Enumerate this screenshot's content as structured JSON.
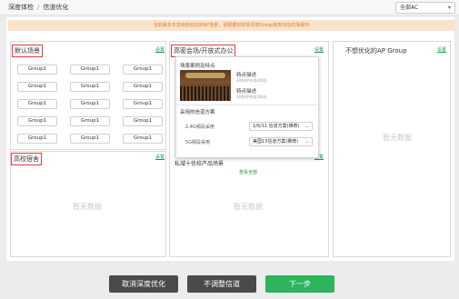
{
  "breadcrumb": {
    "parent": "深度体检",
    "separator": "/",
    "current": "信道优化"
  },
  "scope_select": {
    "value": "全部AC"
  },
  "notice": "当前版本不支持自动识别AP场景，请根据实际情况将Group拖到对应的场景中",
  "columns": {
    "default_scene": {
      "title": "默认场景",
      "setting": "设置",
      "groups": [
        "Group1",
        "Group1",
        "Group1",
        "Group1",
        "Group1",
        "Group1",
        "Group1",
        "Group1",
        "Group1",
        "Group1",
        "Group1",
        "Group1",
        "Group1",
        "Group1",
        "Group1"
      ]
    },
    "dorm": {
      "title": "高校宿舍",
      "setting": "设置",
      "empty": "暂无数据"
    },
    "hall": {
      "title": "高密会场/开放式办公",
      "setting": "设置",
      "empty": "暂无数据"
    },
    "other": {
      "title": "私域十优校产品场景",
      "view_all": "查看全部"
    },
    "not_optimized": {
      "title": "不想优化的AP Group",
      "setting": "设置",
      "empty": "暂无数据"
    }
  },
  "popover": {
    "case_title": "场景案例及特点",
    "feature1_title": "特点描述",
    "feature1_sub": "30台AP并发200台",
    "feature2_title": "特点描述",
    "feature2_sub": "30台AP并发200台",
    "plan_title": "采用的信道方案",
    "band24_label": "2.4G频段采用",
    "band24_value": "1/6/11  信道方案(推荐)",
    "band5_label": "5G频段采用",
    "band5_value": "美国13信道方案(推荐)"
  },
  "buttons": {
    "cancel": "取消深度优化",
    "no_adjust": "不调整信道",
    "next": "下一步"
  },
  "colors": {
    "accent": "#2fb35d",
    "highlight": "#e63a3a",
    "notice_bg": "#fbe3c9",
    "notice_text": "#e07b2f"
  }
}
